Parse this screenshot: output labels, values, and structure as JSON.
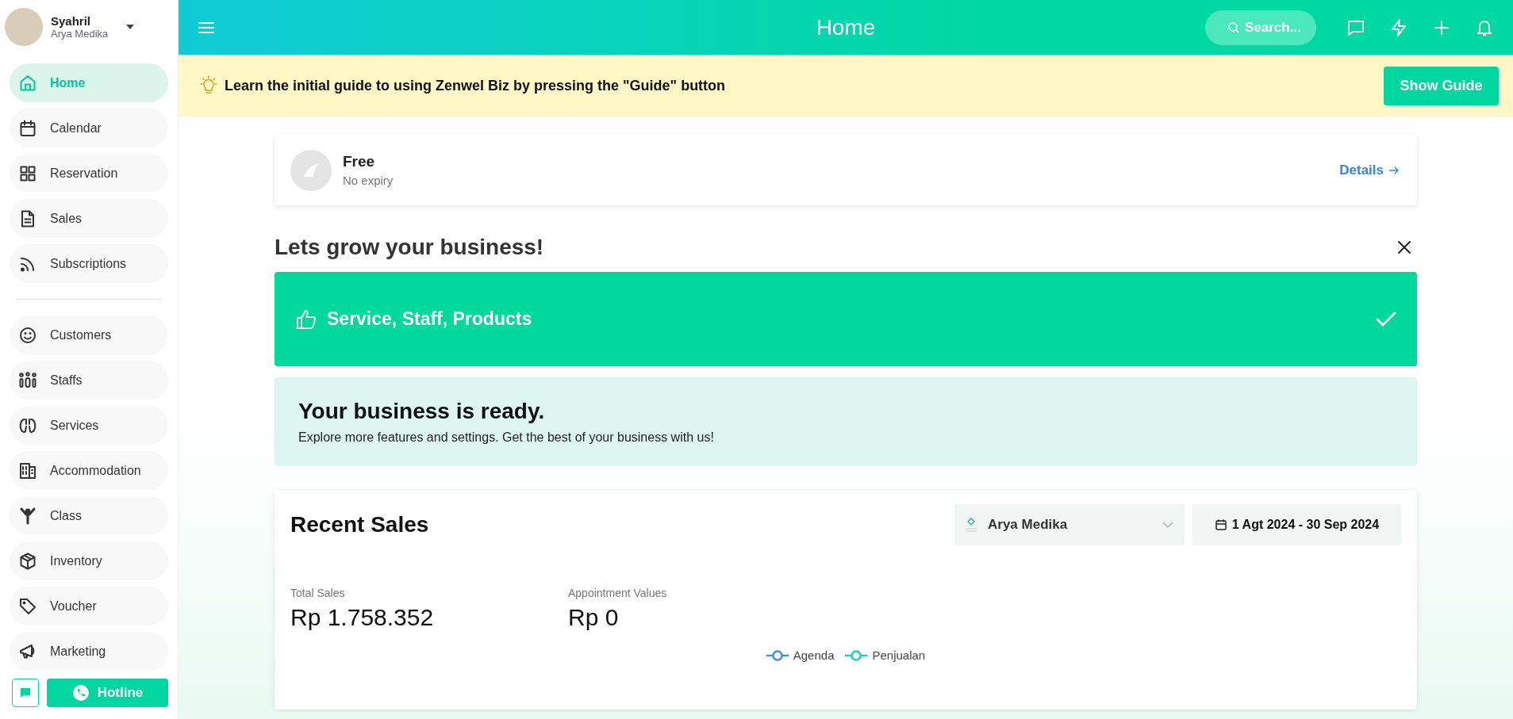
{
  "user": {
    "name": "Syahril",
    "business": "Arya Medika"
  },
  "sidebar": {
    "sections": [
      {
        "items": [
          {
            "label": "Home",
            "selected": true
          },
          {
            "label": "Calendar",
            "selected": false
          },
          {
            "label": "Reservation",
            "selected": false
          },
          {
            "label": "Sales",
            "selected": false
          },
          {
            "label": "Subscriptions",
            "selected": false
          }
        ]
      },
      {
        "items": [
          {
            "label": "Customers",
            "selected": false
          },
          {
            "label": "Staffs",
            "selected": false
          },
          {
            "label": "Services",
            "selected": false
          },
          {
            "label": "Accommodation",
            "selected": false
          },
          {
            "label": "Class",
            "selected": false
          },
          {
            "label": "Inventory",
            "selected": false
          },
          {
            "label": "Voucher",
            "selected": false
          },
          {
            "label": "Marketing",
            "selected": false
          }
        ]
      }
    ],
    "hotline": "Hotline"
  },
  "topbar": {
    "title": "Home",
    "search": {
      "placeholder": "Search..."
    }
  },
  "guide_banner": {
    "text": "Learn the initial guide to using Zenwel Biz by pressing the \"Guide\" button",
    "button": "Show Guide"
  },
  "plan": {
    "name": "Free",
    "expiry": "No expiry",
    "link": "Details"
  },
  "onboarding": {
    "title": "Lets grow your business!",
    "steps": [
      {
        "label": "Service, Staff, Products",
        "done": true
      }
    ],
    "ready": {
      "title": "Your business is ready.",
      "text": "Explore more features and settings. Get the best of your business with us!"
    }
  },
  "recent_sales": {
    "title": "Recent Sales",
    "outlet": "Arya Medika",
    "date_range": "1 Agt 2024 - 30 Sep 2024",
    "stats": [
      {
        "label": "Total Sales",
        "value": "Rp 1.758.352"
      },
      {
        "label": "Appointment Values",
        "value": "Rp 0"
      }
    ],
    "legend": [
      {
        "name": "Agenda",
        "color": "#3d8fe0"
      },
      {
        "name": "Penjualan",
        "color": "#1ad3a6"
      }
    ]
  }
}
